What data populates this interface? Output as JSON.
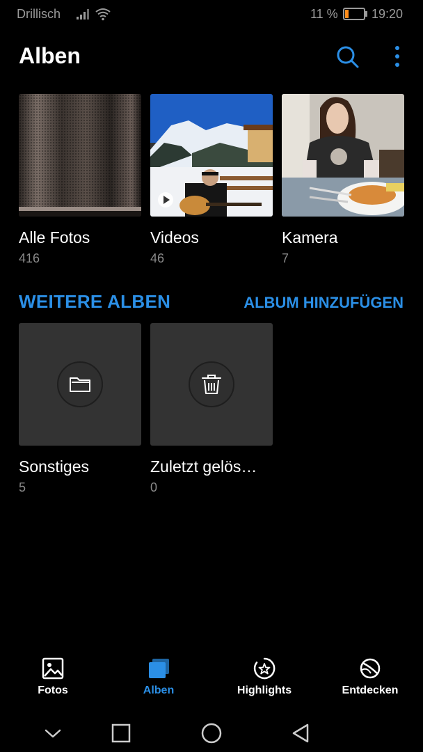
{
  "status_bar": {
    "carrier": "Drillisch",
    "battery_percent": "11 %",
    "time": "19:20"
  },
  "header": {
    "title": "Alben",
    "search_icon": "search-icon",
    "more_icon": "more-vertical-icon"
  },
  "albums": [
    {
      "name": "Alle Fotos",
      "count": "416"
    },
    {
      "name": "Videos",
      "count": "46"
    },
    {
      "name": "Kamera",
      "count": "7"
    }
  ],
  "more_albums": {
    "title": "WEITERE ALBEN",
    "add_label": "ALBUM HINZUFÜGEN",
    "items": [
      {
        "name": "Sonstiges",
        "count": "5",
        "icon": "folder-icon"
      },
      {
        "name": "Zuletzt gelös…",
        "count": "0",
        "icon": "trash-icon"
      }
    ]
  },
  "bottom_nav": [
    {
      "label": "Fotos",
      "icon": "photo-icon",
      "active": false
    },
    {
      "label": "Alben",
      "icon": "albums-icon",
      "active": true
    },
    {
      "label": "Highlights",
      "icon": "highlights-icon",
      "active": false
    },
    {
      "label": "Entdecken",
      "icon": "discover-icon",
      "active": false
    }
  ],
  "colors": {
    "accent": "#2b8fe6",
    "background": "#000000",
    "secondary_text": "#8a8a8a",
    "tile": "#333333"
  }
}
